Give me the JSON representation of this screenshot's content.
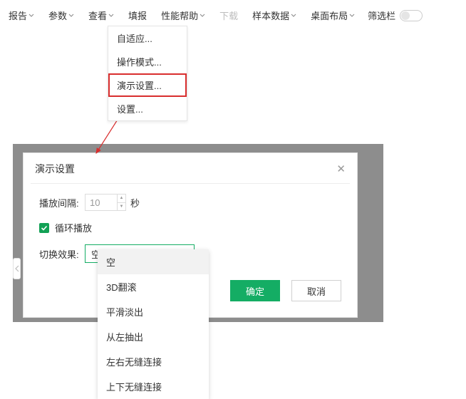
{
  "menubar": {
    "items": [
      {
        "label": "报告",
        "caret": true
      },
      {
        "label": "参数",
        "caret": true
      },
      {
        "label": "查看",
        "caret": true
      },
      {
        "label": "填报",
        "caret": false
      },
      {
        "label": "性能帮助",
        "caret": true
      },
      {
        "label": "下载",
        "caret": false,
        "disabled": true
      },
      {
        "label": "样本数据",
        "caret": true
      },
      {
        "label": "桌面布局",
        "caret": true
      }
    ],
    "filter_label": "筛选栏"
  },
  "dropdown": {
    "items": [
      {
        "label": "自适应..."
      },
      {
        "label": "操作模式..."
      },
      {
        "label": "演示设置...",
        "highlight": true
      },
      {
        "label": "设置..."
      }
    ]
  },
  "dialog": {
    "title": "演示设置",
    "interval_label": "播放间隔:",
    "interval_value": "10",
    "interval_unit": "秒",
    "loop_label": "循环播放",
    "loop_checked": true,
    "effect_label": "切换效果:",
    "effect_value": "空",
    "ok_label": "确定",
    "cancel_label": "取消"
  },
  "options": [
    "空",
    "3D翻滚",
    "平滑淡出",
    "从左抽出",
    "左右无缝连接",
    "上下无缝连接"
  ],
  "options_selected_index": 0,
  "colors": {
    "accent": "#14ad64",
    "highlight_red": "#d92e2e"
  }
}
